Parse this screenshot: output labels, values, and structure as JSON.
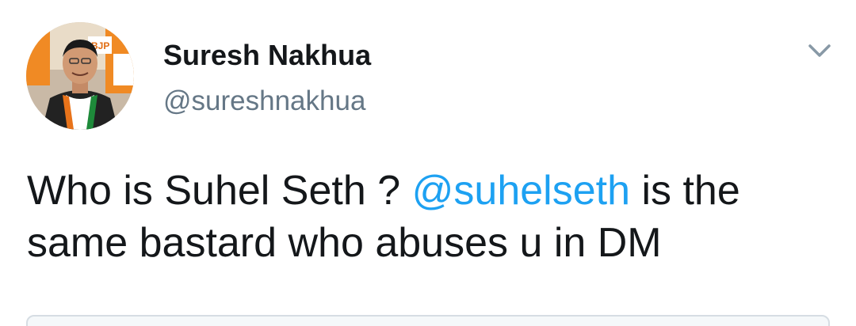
{
  "tweet": {
    "author": {
      "display_name": "Suresh Nakhua",
      "handle": "@sureshnakhua",
      "avatar_icon": "profile-photo",
      "avatar_badge_text": "BJP"
    },
    "menu_icon": "chevron-down-icon",
    "text": {
      "part1": "Who is Suhel Seth ? ",
      "mention": "@suhelseth",
      "part2": " is the same bastard who abuses u in DM"
    },
    "colors": {
      "mention": "#1da1f2",
      "handle": "#657786",
      "text": "#14171a"
    }
  }
}
